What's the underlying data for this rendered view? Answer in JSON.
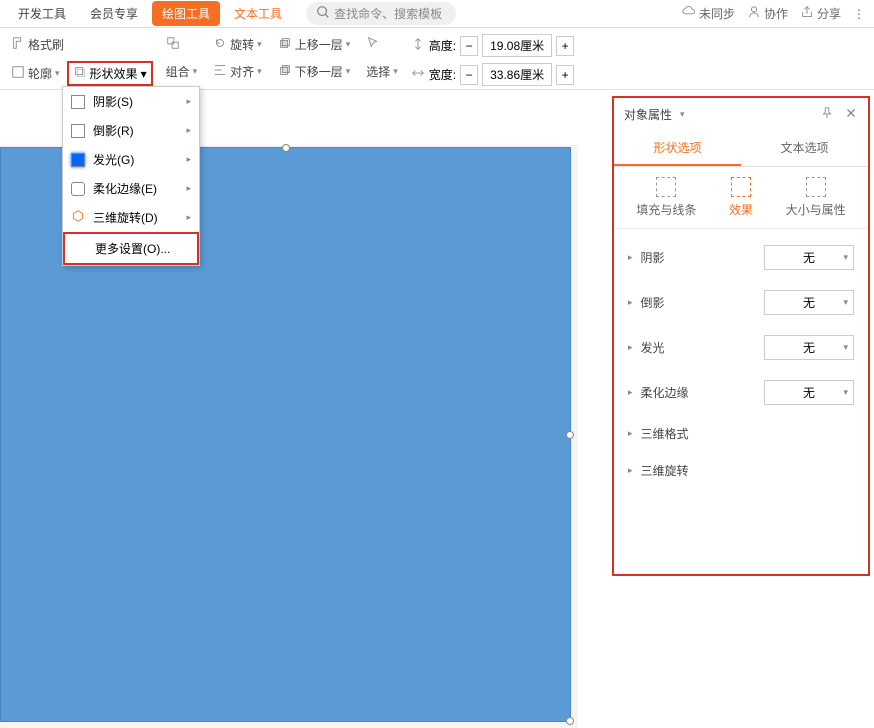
{
  "tabs": {
    "dev": "开发工具",
    "vip": "会员专享",
    "draw": "绘图工具",
    "text": "文本工具"
  },
  "search": {
    "placeholder": "查找命令、搜索模板"
  },
  "topRight": {
    "sync": "未同步",
    "collab": "协作",
    "share": "分享"
  },
  "ribbon": {
    "formatPainter": "格式刷",
    "outline": "轮廓",
    "shapeEffect": "形状效果",
    "group": "组合",
    "rotate": "旋转",
    "align": "对齐",
    "moveUp": "上移一层",
    "moveDown": "下移一层",
    "select": "选择",
    "height": "高度:",
    "width": "宽度:",
    "heightVal": "19.08厘米",
    "widthVal": "33.86厘米"
  },
  "menu": {
    "shadow": "阴影(S)",
    "reflection": "倒影(R)",
    "glow": "发光(G)",
    "softEdge": "柔化边缘(E)",
    "rotate3d": "三维旋转(D)",
    "more": "更多设置(O)..."
  },
  "panel": {
    "title": "对象属性",
    "tabShape": "形状选项",
    "tabText": "文本选项",
    "subFill": "填充与线条",
    "subEffect": "效果",
    "subSize": "大小与属性",
    "props": {
      "shadow": "阴影",
      "reflection": "倒影",
      "glow": "发光",
      "softEdge": "柔化边缘",
      "format3d": "三维格式",
      "rotate3d": "三维旋转"
    },
    "none": "无"
  }
}
